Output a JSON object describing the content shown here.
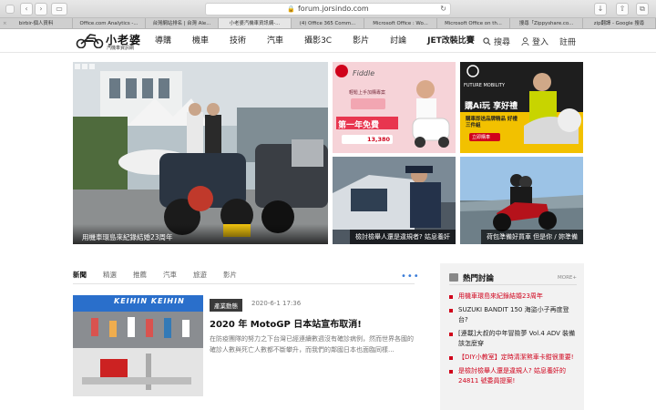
{
  "browser": {
    "url": "forum.jorsindo.com",
    "tabs": [
      "birbir-個人資料",
      "Office.com Analytics -...",
      "台灣網站排名 | 台灣 Ale...",
      "小老婆汽機車資訊網-...",
      "(4) Office 365 Comm...",
      "Microsoft Office : Wo...",
      "Microsoft Office on th...",
      "搜尋「Zippyshare.co...",
      "zip翻譯 - Google 搜尋"
    ]
  },
  "site": {
    "logo_name": "小老婆",
    "logo_sub": "汽機車資訊網",
    "nav": [
      "導購",
      "機車",
      "技術",
      "汽車",
      "攝影3C",
      "影片",
      "討論",
      "JET改裝比賽"
    ],
    "search_label": "搜尋",
    "login_label": "登入",
    "register_label": "註冊"
  },
  "hero": {
    "main_caption": "用機車環島來紀錄結婚23周年",
    "ad1": {
      "brand": "Fiddle",
      "headline": "第一年免費",
      "sub": "輕鬆上手加購專案",
      "price": "13,380"
    },
    "ad2": {
      "brand": "FUTURE MOBILITY",
      "headline": "購Ai玩 享好禮",
      "sub": "購車即送品牌精品 好禮三件組",
      "cta": "立即購車"
    },
    "caption3": "檢討檢舉人還是違規者? 姑息養奸",
    "caption4": "荷包準備好買車 但是你 / 妳準備"
  },
  "news": {
    "tabs": [
      "新聞",
      "精選",
      "推薦",
      "汽車",
      "旅遊",
      "影片"
    ],
    "more": "•••",
    "article": {
      "category": "產業動態",
      "date": "2020-6-1 17:36",
      "title": "2020 年 MotoGP 日本站宣布取消!",
      "excerpt": "在防疫團隊的努力之下台灣已經連續數週沒有確診病例，然而世界各國的確診人數與死亡人數都不斷攀升，而我們的鄰國日本也面臨同樣..."
    }
  },
  "sidebar": {
    "title": "熱門討論",
    "more": "MORE+",
    "items": [
      {
        "text": "用機車環島來紀錄結婚23周年",
        "red": true
      },
      {
        "text": "SUZUKI BANDIT 150 海盜小子再度登台?",
        "red": false
      },
      {
        "text": "[連載]大叔的中年冒險夢 Vol.4 ADV 裝備該怎麼穿",
        "red": false
      },
      {
        "text": "【DIY小教室】定時清潔煞車卡鉗很重要!",
        "red": true
      },
      {
        "text": "是檢討檢舉人還是違規人? 姑息養奸的24811 號委員提案!",
        "red": true
      }
    ]
  },
  "colors": {
    "accent": "#d0021b",
    "link_blue": "#3b7dd8"
  }
}
